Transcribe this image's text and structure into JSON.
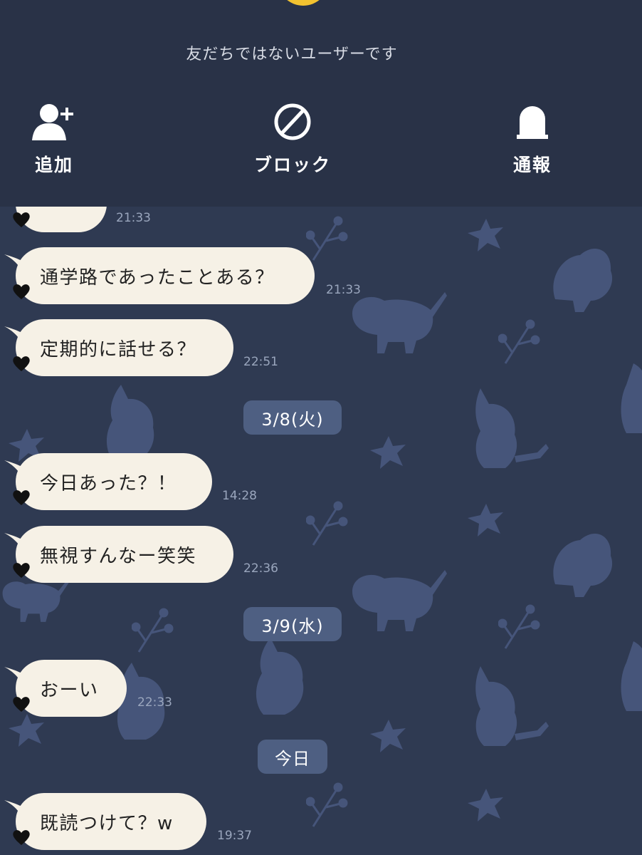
{
  "header": {
    "notice": "友だちではないユーザーです",
    "actions": [
      {
        "label": "追加",
        "icon": "add-friend-icon"
      },
      {
        "label": "ブロック",
        "icon": "block-icon"
      },
      {
        "label": "通報",
        "icon": "report-icon"
      }
    ]
  },
  "chat": {
    "messages": [
      {
        "text": "",
        "time": "21:33"
      },
      {
        "text": "通学路であったことある？",
        "time": "21:33"
      },
      {
        "text": "定期的に話せる？",
        "time": "22:51"
      },
      {
        "text": "今日あった？！",
        "time": "14:28"
      },
      {
        "text": "無視すんなー笑笑",
        "time": "22:36"
      },
      {
        "text": "おーい",
        "time": "22:33"
      },
      {
        "text": "既読つけて？w",
        "time": "19:37"
      }
    ],
    "dates": [
      "3/8(火)",
      "3/9(水)",
      "今日"
    ]
  },
  "colors": {
    "header_bg": "#293247",
    "chat_bg": "#2f3a52",
    "bubble": "#f6f1e6",
    "date_pill": "#4e5f82",
    "avatar_accent": "#f2c230"
  }
}
